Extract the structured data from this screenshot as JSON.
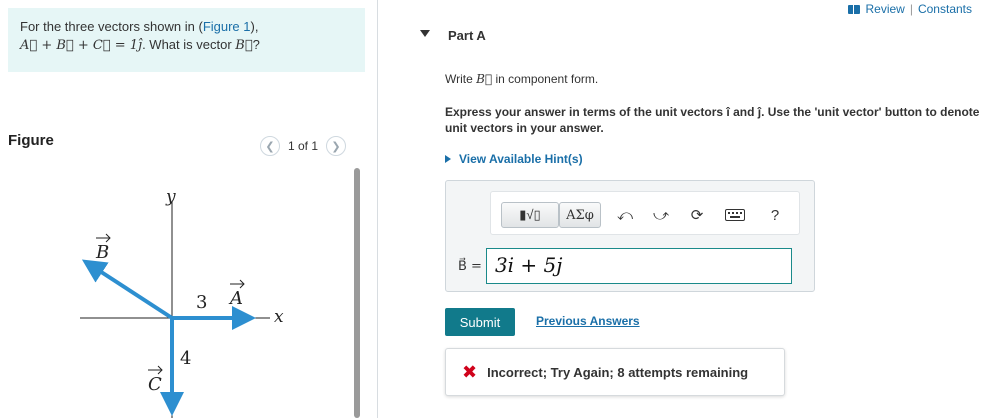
{
  "problem": {
    "prefix": "For the three vectors shown in (",
    "figure_link": "Figure 1",
    "suffix": "),",
    "equation": "A⃗ + B⃗ + C⃗ = 1ĵ",
    "question": ". What is vector ",
    "question_vector": "B⃗",
    "question_end": "?"
  },
  "figure": {
    "title": "Figure",
    "pager_text": "1 of 1",
    "axis_y": "y",
    "axis_x": "x",
    "vec_a": "A",
    "vec_b": "B",
    "vec_c": "C",
    "len_a": "3",
    "len_c": "4",
    "colors": {
      "vector": "#2d8fd0",
      "axis": "#222222"
    }
  },
  "header": {
    "review": "Review",
    "separator": "|",
    "constants": "Constants"
  },
  "part": {
    "title": "Part A",
    "instr1_pre": "Write ",
    "instr1_vec": "B⃗",
    "instr1_post": " in component form.",
    "instr2": "Express your answer in terms of the unit vectors î and ĵ. Use the 'unit vector' button to denote unit vectors in your answer.",
    "hint": "View Available Hint(s)"
  },
  "answer": {
    "toolbar": {
      "templates_label": "▮√▯",
      "greek_label": "ΑΣφ",
      "help_label": "?"
    },
    "label": "B⃗ =",
    "value": "3i + 5j"
  },
  "actions": {
    "submit": "Submit",
    "previous_answers": "Previous Answers"
  },
  "feedback": {
    "message": "Incorrect; Try Again; 8 attempts remaining",
    "color": "#d0021b"
  }
}
